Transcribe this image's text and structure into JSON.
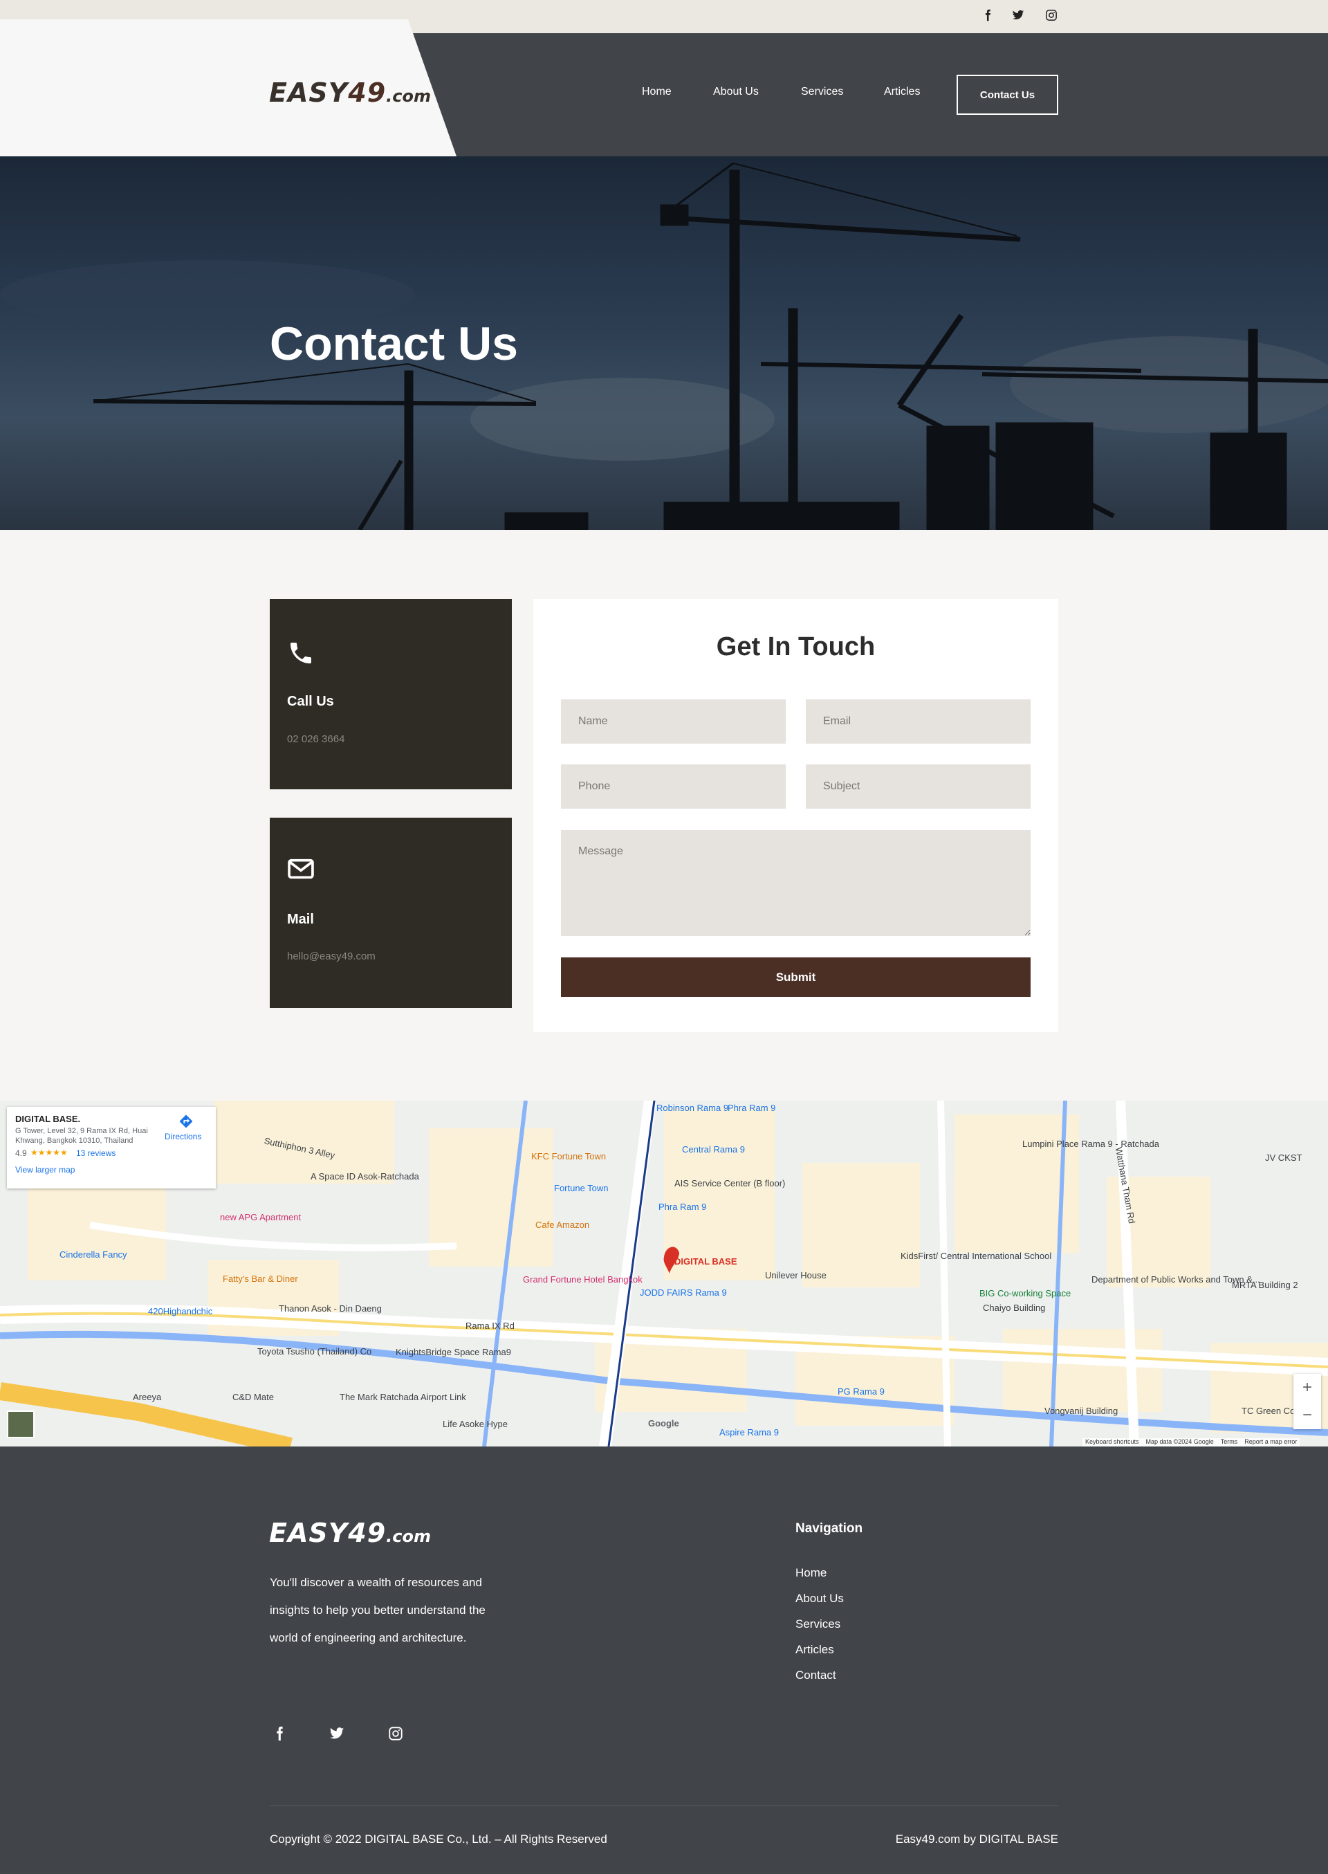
{
  "site": {
    "logo_main": "EASY",
    "logo_num": "49",
    "logo_dom": ".com"
  },
  "topbar": {
    "social": [
      "facebook-icon",
      "twitter-icon",
      "instagram-icon"
    ]
  },
  "nav": {
    "items": [
      "Home",
      "About Us",
      "Services",
      "Articles"
    ],
    "cta": "Contact Us"
  },
  "hero": {
    "title": "Contact Us"
  },
  "contact_cards": [
    {
      "title": "Call Us",
      "value": "02 026 3664",
      "icon": "phone-icon"
    },
    {
      "title": "Mail",
      "value": "hello@easy49.com",
      "icon": "envelope-icon"
    }
  ],
  "form": {
    "title": "Get In Touch",
    "name_placeholder": "Name",
    "email_placeholder": "Email",
    "phone_placeholder": "Phone",
    "subject_placeholder": "Subject",
    "message_placeholder": "Message",
    "submit_label": "Submit"
  },
  "map": {
    "place_name": "DIGITAL BASE.",
    "address": "G Tower, Level 32, 9 Rama IX Rd, Huai Khwang, Bangkok 10310, Thailand",
    "rating": "4.9",
    "stars": "★★★★★",
    "reviews": "13 reviews",
    "directions": "Directions",
    "larger_map": "View larger map",
    "pin_label": "DIGITAL BASE",
    "zoom_in": "+",
    "zoom_out": "−",
    "attribution": {
      "keyboard": "Keyboard shortcuts",
      "data": "Map data ©2024 Google",
      "terms": "Terms",
      "report": "Report a map error",
      "google": "Google"
    },
    "labels": [
      "Robinson Rama 9",
      "Central Rama 9",
      "KFC Fortune Town",
      "Fortune Town",
      "AIS Service Center (B floor)",
      "Phra Ram 9",
      "Cafe Amazon",
      "Grand Fortune Hotel Bangkok",
      "JODD FAIRS Rama 9",
      "Unilever House",
      "KidsFirst/ Central International School",
      "BIG Co-working Space",
      "Chaiyo Building",
      "Lumpini Place Rama 9 - Ratchada",
      "JV CKST",
      "Department of Public Works and Town &...",
      "MRTA Building 2",
      "A Space ID Asok-Ratchada",
      "new APG Apartment",
      "Cinderella Fancy",
      "Fatty's Bar & Diner",
      "420Highandchic",
      "Toyota Tsusho (Thailand) Co",
      "KnightsBridge Space Rama9",
      "The Mark Ratchada Airport Link",
      "Areeya",
      "C&D Mate",
      "Life Asoke Hype",
      "PG Rama 9",
      "Vongvanij Building",
      "Aspire Rama 9",
      "TC Green Co",
      "Thanon Asok - Din Daeng",
      "Rama IX Rd",
      "Sutthiphon 3 Alley",
      "Watthana Tham Rd",
      "Phra Ram 9"
    ]
  },
  "footer": {
    "description": "You'll discover a wealth of resources and insights to help you better understand the world of engineering and architecture.",
    "nav_title": "Navigation",
    "links": [
      "Home",
      "About Us",
      "Services",
      "Articles",
      "Contact"
    ],
    "copyright": "Copyright © 2022 DIGITAL BASE Co., Ltd. – All Rights Reserved",
    "credit": "Easy49.com by DIGITAL BASE"
  },
  "colors": {
    "brand_brown": "#4b2e24",
    "header_gray": "#414448",
    "card_dark": "#2e2c25",
    "topbar": "#ebe7e1"
  }
}
